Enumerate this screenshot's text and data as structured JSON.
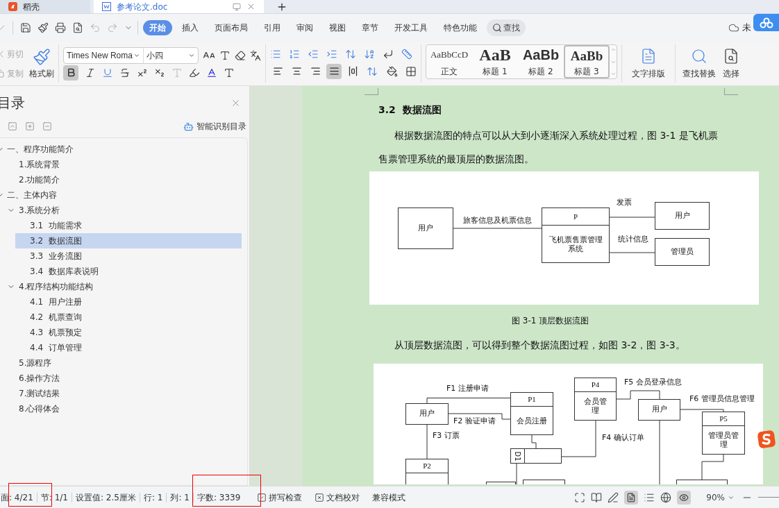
{
  "tabs": [
    {
      "label": "稻壳",
      "selected": false,
      "kind": "home"
    },
    {
      "label": "参考论文.doc",
      "selected": true,
      "kind": "doc"
    }
  ],
  "menu": [
    {
      "label": "开始",
      "selected": true
    },
    {
      "label": "插入",
      "selected": false
    },
    {
      "label": "页面布局",
      "selected": false
    },
    {
      "label": "引用",
      "selected": false
    },
    {
      "label": "审阅",
      "selected": false
    },
    {
      "label": "视图",
      "selected": false
    },
    {
      "label": "章节",
      "selected": false
    },
    {
      "label": "开发工具",
      "selected": false
    },
    {
      "label": "特色功能",
      "selected": false
    }
  ],
  "search_button": "查找",
  "sync_status": "未",
  "ribbon": {
    "clipboard": [
      {
        "label": "剪切",
        "disabled": true
      },
      {
        "label": "复制",
        "disabled": true
      }
    ],
    "format_painter": "格式刷",
    "font": {
      "value": "Times New Roma"
    },
    "font_size": {
      "value": "小四"
    },
    "bold": {
      "on": true
    },
    "alignment": [
      {
        "kind": "left",
        "selected": false
      },
      {
        "kind": "center",
        "selected": false
      },
      {
        "kind": "right",
        "selected": false
      },
      {
        "kind": "justify",
        "selected": true
      },
      {
        "kind": "distributed",
        "selected": false
      }
    ],
    "styles": [
      {
        "sample": "AaBbCcD",
        "label": "正文",
        "kind": "body",
        "selected": false
      },
      {
        "sample": "AaB",
        "label": "标题 1",
        "kind": "h1",
        "selected": false
      },
      {
        "sample": "AaBb",
        "label": "标题 2",
        "kind": "h2",
        "selected": false
      },
      {
        "sample": "AaBb",
        "label": "标题 3",
        "kind": "h3",
        "selected": true
      }
    ],
    "typesetting": "文字排版",
    "find_replace": "查找替换",
    "select": "选择"
  },
  "outline": {
    "title": "目录",
    "smart_button": "智能识别目录",
    "items": [
      {
        "label": "一、程序功能简介",
        "expanded": true,
        "selected": false,
        "children": [
          {
            "label": "1.系统背景",
            "selected": false
          },
          {
            "label": "2.功能简介",
            "selected": false
          }
        ]
      },
      {
        "label": "二、主体内容",
        "expanded": true,
        "selected": false,
        "children": [
          {
            "label": "3.系统分析",
            "expanded": true,
            "selected": false,
            "children": [
              {
                "label": "3.1  功能需求",
                "selected": false
              },
              {
                "label": "3.2  数据流图",
                "selected": true
              },
              {
                "label": "3.3  业务流图",
                "selected": false
              },
              {
                "label": "3.4  数据库表说明",
                "selected": false
              }
            ]
          },
          {
            "label": "4.程序结构功能结构",
            "expanded": true,
            "selected": false,
            "children": [
              {
                "label": "4.1  用户注册",
                "selected": false
              },
              {
                "label": "4.2  机票查询",
                "selected": false
              },
              {
                "label": "4.3  机票预定",
                "selected": false
              },
              {
                "label": "4.4  订单管理",
                "selected": false
              }
            ]
          },
          {
            "label": "5.源程序",
            "selected": false
          },
          {
            "label": "6.操作方法",
            "selected": false
          },
          {
            "label": "7.测试结果",
            "selected": false
          },
          {
            "label": "8.心得体会",
            "selected": false
          }
        ]
      }
    ]
  },
  "document": {
    "heading": "3.2  数据流图",
    "paragraph_1": "根据数据流图的特点可以从大到小逐渐深入系统处理过程，图 3-1 是飞机票售票管理系统的最顶层的数据流图。",
    "figure_1": {
      "nodes": [
        {
          "kind": "entity",
          "label": "用户"
        },
        {
          "kind": "process",
          "id_label": "P",
          "label": "飞机票售票管理系统"
        },
        {
          "kind": "entity",
          "label": "用户"
        },
        {
          "kind": "entity",
          "label": "管理员"
        }
      ],
      "flows": [
        "旅客信息及机票信息",
        "发票",
        "统计信息"
      ]
    },
    "caption_1": "图 3-1 顶层数据流图",
    "paragraph_2": "从顶层数据流图，可以得到整个数据流图过程，如图 3-2，图 3-3。",
    "figure_2": {
      "nodes": [
        {
          "kind": "entity",
          "label": "用户"
        },
        {
          "kind": "process",
          "id_label": "P1",
          "label": "会员注册"
        },
        {
          "kind": "process",
          "id_label": "P2"
        },
        {
          "kind": "store",
          "id_label": "D1"
        },
        {
          "kind": "process",
          "id_label": "P4",
          "label": "会员管理"
        },
        {
          "kind": "entity",
          "label": "用户"
        },
        {
          "kind": "process",
          "id_label": "P5",
          "label": "管理员管理"
        },
        {
          "kind": "box"
        },
        {
          "kind": "box"
        },
        {
          "kind": "box"
        }
      ],
      "flows": [
        "F1 注册申请",
        "F2 验证申请",
        "F3 订票",
        "F4 确认订单",
        "F5 会员登录信息",
        "F6 管理员信息管理"
      ]
    }
  },
  "status_bar": {
    "fields": [
      "面: 4/21",
      "节: 1/1",
      "设置值: 2.5厘米",
      "行: 1",
      "列: 1",
      "字数: 3339"
    ],
    "spell_check": "拼写检查",
    "proofread": "文档校对",
    "compat_mode": "兼容模式",
    "zoom": "90%"
  }
}
